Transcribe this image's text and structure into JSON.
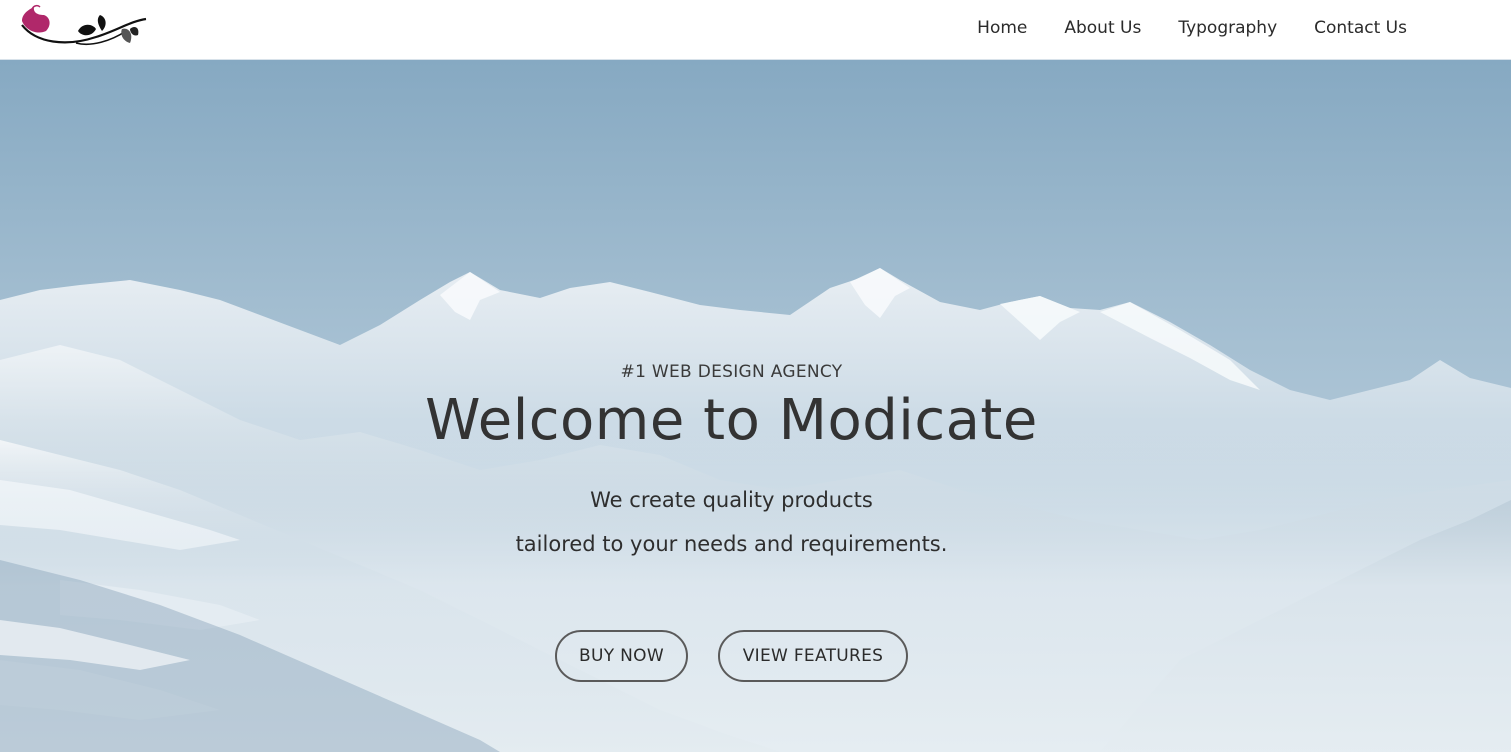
{
  "header": {
    "logo_icon": "flower-vine-logo",
    "nav": [
      {
        "label": "Home"
      },
      {
        "label": "About Us"
      },
      {
        "label": "Typography"
      },
      {
        "label": "Contact Us"
      }
    ]
  },
  "hero": {
    "background": "snowy-mountain-range",
    "tagline": "#1 WEB DESIGN AGENCY",
    "title": "Welcome to Modicate",
    "subtitle_line1": "We create quality products",
    "subtitle_line2": "tailored to your needs and requirements.",
    "buy_button": "BUY NOW",
    "features_button": "VIEW FEATURES"
  },
  "colors": {
    "logo_accent": "#b0286a",
    "text_dark": "#333333",
    "sky": "#8fb0c7",
    "button_border": "#5a5a5a"
  }
}
